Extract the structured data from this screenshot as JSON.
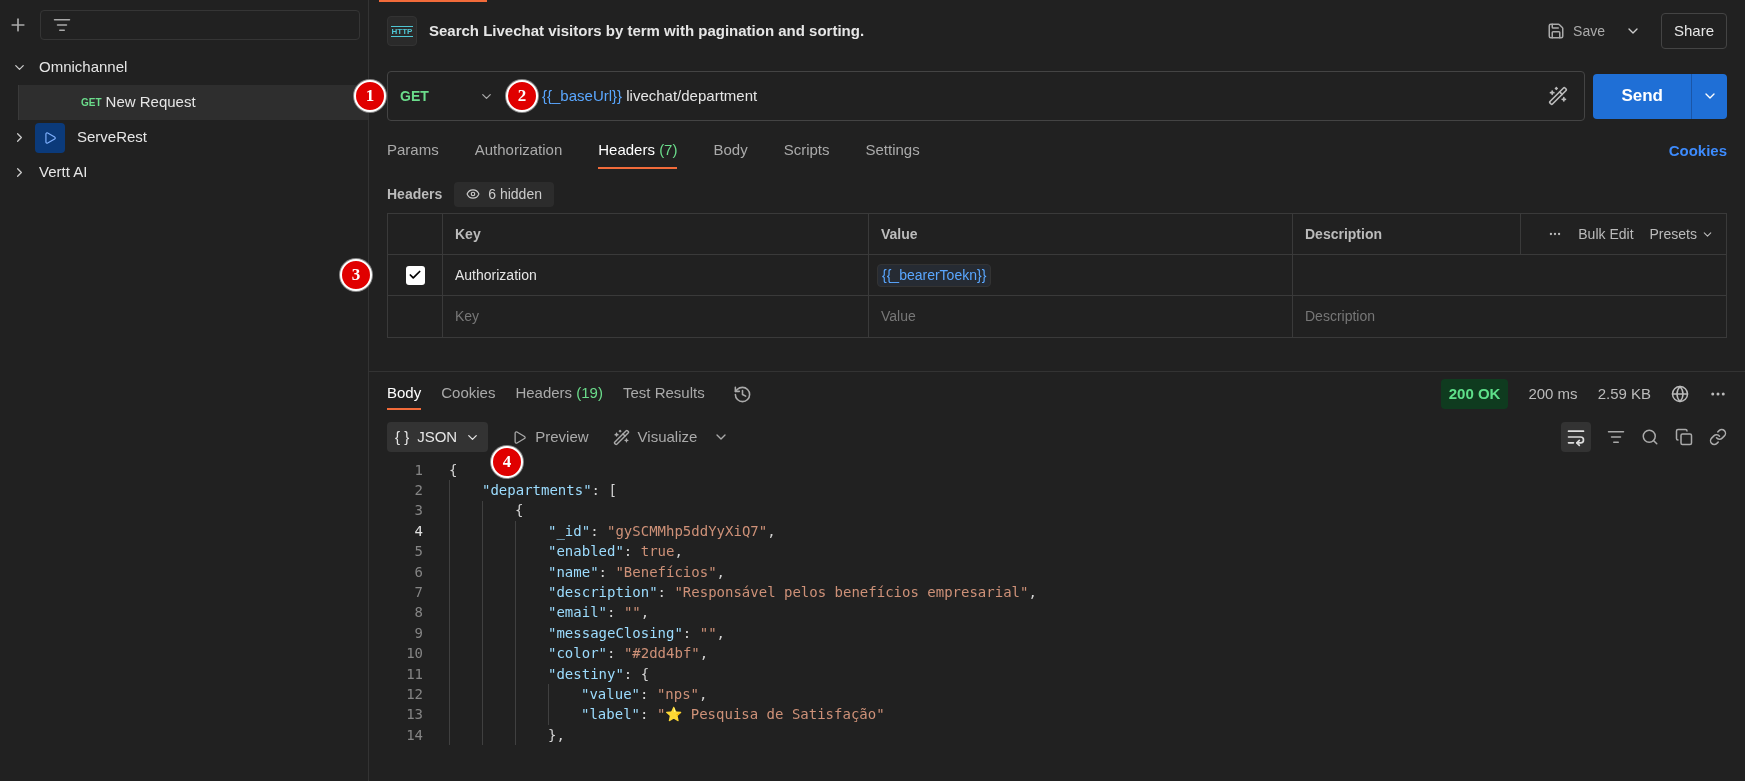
{
  "sidebar": {
    "items": [
      {
        "label": "Omnichannel",
        "expanded": true,
        "selected": false,
        "children": [
          {
            "label": "New Request",
            "method": "GET",
            "selected": true
          }
        ]
      },
      {
        "label": "ServeRest",
        "expanded": false,
        "selected": false,
        "kind": "badge"
      },
      {
        "label": "Vertt AI",
        "expanded": false,
        "selected": false
      }
    ]
  },
  "request": {
    "http_badge": "HTTP",
    "title": "Search Livechat visitors by term with pagination and sorting.",
    "save": "Save",
    "share": "Share",
    "method": "GET",
    "url_variable": "{{_baseUrl}}",
    "url_path": " livechat/department",
    "send": "Send",
    "tabs": [
      {
        "label": "Params",
        "selected": false
      },
      {
        "label": "Authorization",
        "selected": false
      },
      {
        "label": "Headers",
        "count": "(7)",
        "selected": true
      },
      {
        "label": "Body",
        "selected": false
      },
      {
        "label": "Scripts",
        "selected": false
      },
      {
        "label": "Settings",
        "selected": false
      }
    ],
    "cookies": "Cookies",
    "headers_label": "Headers",
    "hidden": "6 hidden",
    "table": {
      "columns": [
        "Key",
        "Value",
        "Description"
      ],
      "bulk_edit": "Bulk Edit",
      "presets": "Presets",
      "rows": [
        {
          "checked": true,
          "key": "Authorization",
          "value": "{{_bearerToekn}}"
        }
      ],
      "placeholder_row": {
        "key": "Key",
        "value": "Value",
        "description": "Description"
      }
    }
  },
  "response": {
    "tabs": [
      {
        "label": "Body",
        "selected": true
      },
      {
        "label": "Cookies",
        "selected": false
      },
      {
        "label": "Headers",
        "count": "(19)",
        "selected": false
      },
      {
        "label": "Test Results",
        "selected": false
      }
    ],
    "status": "200 OK",
    "time": "200 ms",
    "size": "2.59 KB",
    "format_symbol": "{ }",
    "format": "JSON",
    "preview": "Preview",
    "visualize": "Visualize",
    "code": [
      {
        "number": "1",
        "tokens": [
          {
            "kind": "punct",
            "text": "{"
          }
        ],
        "children": [
          {
            "number": "2",
            "tokens": [
              {
                "kind": "key",
                "text": "\"departments\""
              },
              {
                "kind": "punct",
                "text": ": ["
              }
            ],
            "children": [
              {
                "number": "3",
                "tokens": [
                  {
                    "kind": "punct",
                    "text": "{"
                  }
                ],
                "children": [
                  {
                    "number": "4",
                    "current": true,
                    "tokens": [
                      {
                        "kind": "key",
                        "text": "\"_id\""
                      },
                      {
                        "kind": "punct",
                        "text": ": "
                      },
                      {
                        "kind": "string",
                        "text": "\"gySCMMhp5ddYyXiQ7\""
                      },
                      {
                        "kind": "punct",
                        "text": ","
                      }
                    ]
                  },
                  {
                    "number": "5",
                    "tokens": [
                      {
                        "kind": "key",
                        "text": "\"enabled\""
                      },
                      {
                        "kind": "punct",
                        "text": ": "
                      },
                      {
                        "kind": "string",
                        "text": "true"
                      },
                      {
                        "kind": "punct",
                        "text": ","
                      }
                    ]
                  },
                  {
                    "number": "6",
                    "tokens": [
                      {
                        "kind": "key",
                        "text": "\"name\""
                      },
                      {
                        "kind": "punct",
                        "text": ": "
                      },
                      {
                        "kind": "string",
                        "text": "\"Benefícios\""
                      },
                      {
                        "kind": "punct",
                        "text": ","
                      }
                    ]
                  },
                  {
                    "number": "7",
                    "tokens": [
                      {
                        "kind": "key",
                        "text": "\"description\""
                      },
                      {
                        "kind": "punct",
                        "text": ": "
                      },
                      {
                        "kind": "string",
                        "text": "\"Responsável pelos benefícios empresarial\""
                      },
                      {
                        "kind": "punct",
                        "text": ","
                      }
                    ]
                  },
                  {
                    "number": "8",
                    "tokens": [
                      {
                        "kind": "key",
                        "text": "\"email\""
                      },
                      {
                        "kind": "punct",
                        "text": ": "
                      },
                      {
                        "kind": "string",
                        "text": "\"\""
                      },
                      {
                        "kind": "punct",
                        "text": ","
                      }
                    ]
                  },
                  {
                    "number": "9",
                    "tokens": [
                      {
                        "kind": "key",
                        "text": "\"messageClosing\""
                      },
                      {
                        "kind": "punct",
                        "text": ": "
                      },
                      {
                        "kind": "string",
                        "text": "\"\""
                      },
                      {
                        "kind": "punct",
                        "text": ","
                      }
                    ]
                  },
                  {
                    "number": "10",
                    "tokens": [
                      {
                        "kind": "key",
                        "text": "\"color\""
                      },
                      {
                        "kind": "punct",
                        "text": ": "
                      },
                      {
                        "kind": "string",
                        "text": "\"#2dd4bf\""
                      },
                      {
                        "kind": "punct",
                        "text": ","
                      }
                    ]
                  },
                  {
                    "number": "11",
                    "tokens": [
                      {
                        "kind": "key",
                        "text": "\"destiny\""
                      },
                      {
                        "kind": "punct",
                        "text": ": {"
                      }
                    ],
                    "children": [
                      {
                        "number": "12",
                        "tokens": [
                          {
                            "kind": "key",
                            "text": "\"value\""
                          },
                          {
                            "kind": "punct",
                            "text": ": "
                          },
                          {
                            "kind": "string",
                            "text": "\"nps\""
                          },
                          {
                            "kind": "punct",
                            "text": ","
                          }
                        ]
                      },
                      {
                        "number": "13",
                        "tokens": [
                          {
                            "kind": "key",
                            "text": "\"label\""
                          },
                          {
                            "kind": "punct",
                            "text": ": "
                          },
                          {
                            "kind": "string",
                            "text": "\"⭐ Pesquisa de Satisfação\""
                          }
                        ]
                      }
                    ]
                  },
                  {
                    "number": "14",
                    "tokens": [
                      {
                        "kind": "punct",
                        "text": "},"
                      }
                    ]
                  }
                ]
              }
            ]
          }
        ]
      }
    ]
  },
  "markers": [
    "1",
    "2",
    "3",
    "4"
  ]
}
